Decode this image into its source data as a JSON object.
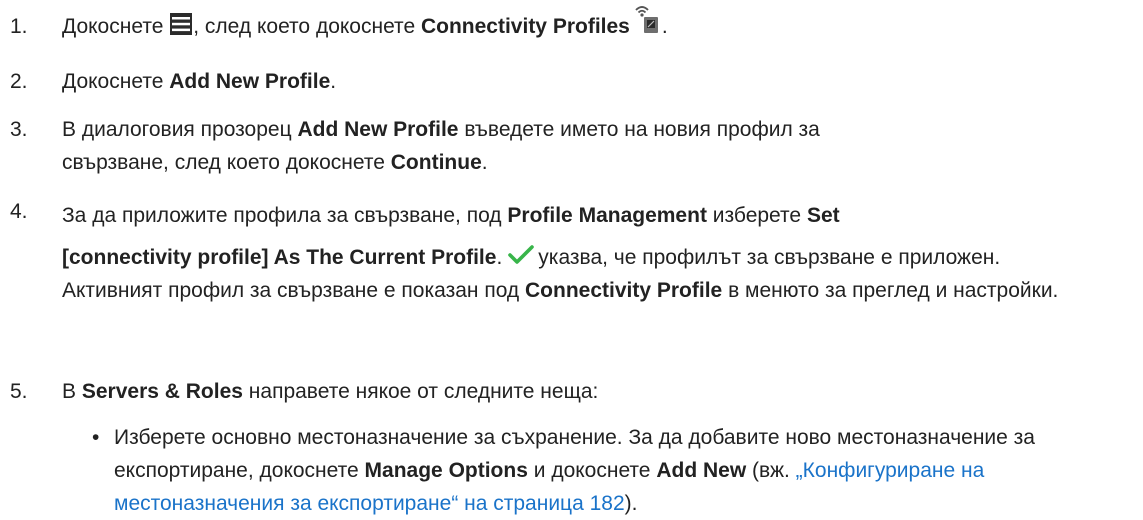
{
  "steps": [
    {
      "num": "1.",
      "t1": "Докоснете",
      "t2": ", след което докоснете",
      "b1": "Connectivity Profiles",
      "t3": "."
    },
    {
      "num": "2.",
      "t1": "Докоснете",
      "b1": "Add New Profile",
      "t2": "."
    },
    {
      "num": "3.",
      "t1": "В диалоговия прозорец",
      "b1": "Add New Profile",
      "t2": "въведете името на новия профил за свързване, след което докоснете",
      "b2": "Continue",
      "t3": "."
    },
    {
      "num": "4.",
      "t1": "За да приложите профила за свързване, под",
      "b1": "Profile Management",
      "t2": "изберете",
      "b2": "Set",
      "b3": "[connectivity profile] As The Current Profile",
      "t3": ".",
      "t4": "указва, че профилът за свързване е приложен. Активният профил за свързване е показан под",
      "b4": "Connectivity Profile",
      "t5": "в менюто за преглед и настройки."
    },
    {
      "num": "5.",
      "t1": "В",
      "b1": "Servers & Roles",
      "t2": "направете някое от следните неща:"
    }
  ],
  "bullet": {
    "dot": "•",
    "t1": "Изберете основно местоназначение за съхранение. За да добавите ново местоназначение за експортиране, докоснете",
    "b1": "Manage Options",
    "t2": "и докоснете",
    "b2": "Add New",
    "t3": "(вж.",
    "link": "„Конфигуриране на местоназначения за експортиране“ на страница 182",
    "t4": ")."
  },
  "icons": {
    "menu": "hamburger-menu-icon",
    "connectivity": "connectivity-profiles-icon",
    "check": "checkmark-icon"
  },
  "colors": {
    "text": "#222222",
    "link": "#1a73c9",
    "check": "#38b54a"
  }
}
